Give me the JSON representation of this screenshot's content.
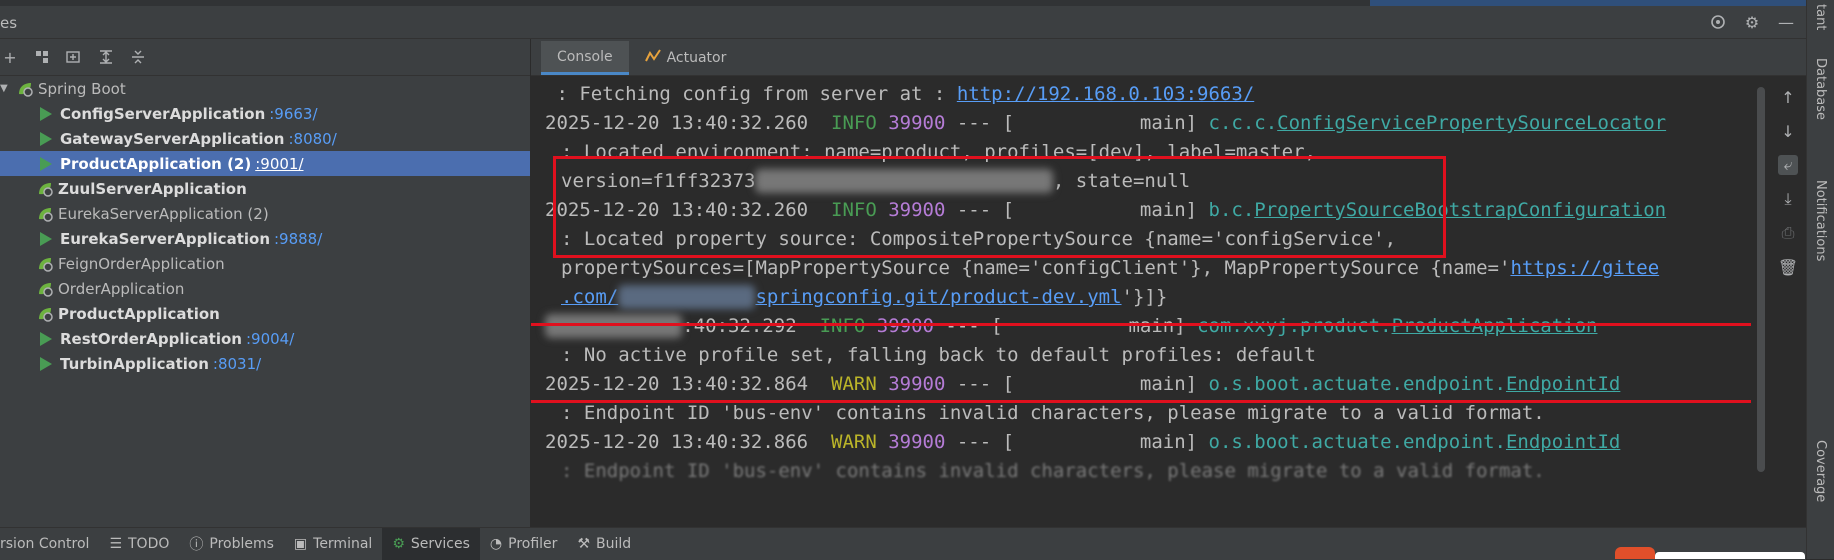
{
  "window": {
    "title_fragment": "es"
  },
  "left_panel": {
    "tree": [
      {
        "label": "Spring Boot",
        "type": "group"
      },
      {
        "label": "ConfigServerApplication",
        "port": ":9663/",
        "state": "running",
        "bold": true
      },
      {
        "label": "GatewayServerApplication",
        "port": ":8080/",
        "state": "running",
        "bold": true
      },
      {
        "label": "ProductApplication (2)",
        "port": ":9001/",
        "state": "running",
        "bold": true,
        "selected": true
      },
      {
        "label": "ZuulServerApplication",
        "port": "",
        "state": "spring",
        "bold": true
      },
      {
        "label": "EurekaServerApplication (2)",
        "port": "",
        "state": "spring",
        "bold": false
      },
      {
        "label": "EurekaServerApplication",
        "port": ":9888/",
        "state": "running",
        "bold": true
      },
      {
        "label": "FeignOrderApplication",
        "port": "",
        "state": "spring",
        "bold": false
      },
      {
        "label": "OrderApplication",
        "port": "",
        "state": "spring",
        "bold": false
      },
      {
        "label": "ProductApplication",
        "port": "",
        "state": "spring",
        "bold": true
      },
      {
        "label": "RestOrderApplication",
        "port": ":9004/",
        "state": "running",
        "bold": true
      },
      {
        "label": "TurbinApplication",
        "port": ":8031/",
        "state": "running",
        "bold": true
      }
    ]
  },
  "tabs": [
    {
      "label": "Console",
      "active": true
    },
    {
      "label": "Actuator",
      "active": false
    }
  ],
  "console": {
    "l1_prefix": " : Fetching config from server at : ",
    "l1_link": "http://192.168.0.103:9663/",
    "l2_time": "2025-12-20 13:40:32.260",
    "l2_level": "INFO",
    "l2_pid": "39900",
    "l2_mid": " --- [           main] ",
    "l2_logger_pre": "c.c.c.",
    "l2_logger": "ConfigServicePropertySourceLocator",
    "l3": ": Located environment: name=product, profiles=[dev], label=master,",
    "l4_prefix": "version=f1ff32373",
    "l4_suffix": ", state=null",
    "l5_time": "2025-12-20 13:40:32.260",
    "l5_level": "INFO",
    "l5_pid": "39900",
    "l5_mid": " --- [           main] ",
    "l5_logger_pre": "b.c.",
    "l5_logger": "PropertySourceBootstrapConfiguration",
    "l6": ": Located property source: CompositePropertySource {name='configService',",
    "l7_prefix": "propertySources=[MapPropertySource {name='configClient'}, MapPropertySource {name='",
    "l7_link": "https://gitee",
    "l8_link_a": ".com/",
    "l8_link_b": "springconfig.git/product-dev.yml",
    "l8_suffix": "'}]}",
    "l9_time_tail": ":40:32.292",
    "l9_level": "INFO",
    "l9_pid": "39900",
    "l9_mid": " --- [           main] ",
    "l9_logger_pre": "com.xxyj.product.",
    "l9_logger": "ProductApplication",
    "l10": ": No active profile set, falling back to default profiles: default",
    "l11_time": "2025-12-20 13:40:32.864",
    "l11_level": "WARN",
    "l11_pid": "39900",
    "l11_mid": " --- [           main] ",
    "l11_logger_pre": "o.s.boot.actuate.endpoint.",
    "l11_logger": "EndpointId",
    "l12": ": Endpoint ID 'bus-env' contains invalid characters, please migrate to a valid format.",
    "l13_time": "2025-12-20 13:40:32.866",
    "l13_level": "WARN",
    "l13_pid": "39900",
    "l13_mid": " --- [           main] ",
    "l13_logger_pre": "o.s.boot.actuate.endpoint.",
    "l13_logger": "EndpointId"
  },
  "right_sidebar": {
    "database": "Database",
    "notifications": "Notifications",
    "coverage": "Coverage",
    "top": "tant"
  },
  "bottom_bar": [
    {
      "label": "rsion Control",
      "icon": "",
      "active": false
    },
    {
      "label": "TODO",
      "icon": "list-icon",
      "active": false
    },
    {
      "label": "Problems",
      "icon": "info-icon",
      "active": false
    },
    {
      "label": "Terminal",
      "icon": "terminal-icon",
      "active": false
    },
    {
      "label": "Services",
      "icon": "services-icon",
      "active": true
    },
    {
      "label": "Profiler",
      "icon": "profiler-icon",
      "active": false
    },
    {
      "label": "Build",
      "icon": "build-icon",
      "active": false
    }
  ],
  "colors": {
    "accent": "#4b6eaf",
    "info": "#499c54",
    "warn": "#bbb529",
    "pid": "#b57cd6",
    "logger": "#3fa9a4",
    "link": "#589df6",
    "highlight_box": "#e0101e"
  }
}
